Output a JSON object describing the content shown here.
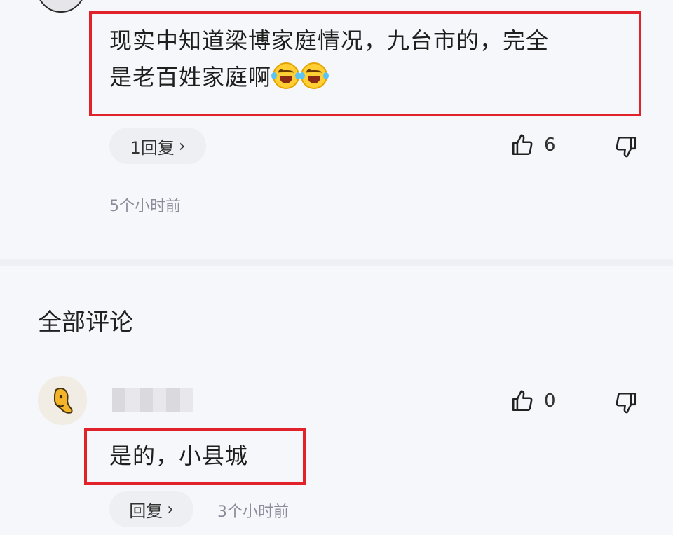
{
  "comment1": {
    "text_line1": "现实中知道梁博家庭情况，九台市的，完全",
    "text_line2": "是老百姓家庭啊",
    "reply_label": "1回复",
    "likes": "6",
    "time": "5个小时前"
  },
  "section": {
    "title": "全部评论"
  },
  "comment2": {
    "likes": "0",
    "text": "是的，小县城",
    "reply_label": "回复",
    "time": "3个小时前"
  },
  "colors": {
    "highlight": "#e2222b",
    "background": "#f6f7fb",
    "pill": "#eeeff3",
    "muted": "#8a8c99"
  },
  "icons": [
    "thumbs-up-icon",
    "thumbs-down-icon",
    "chevron-right-icon",
    "laughing-crying-emoji-icon",
    "avatar"
  ]
}
